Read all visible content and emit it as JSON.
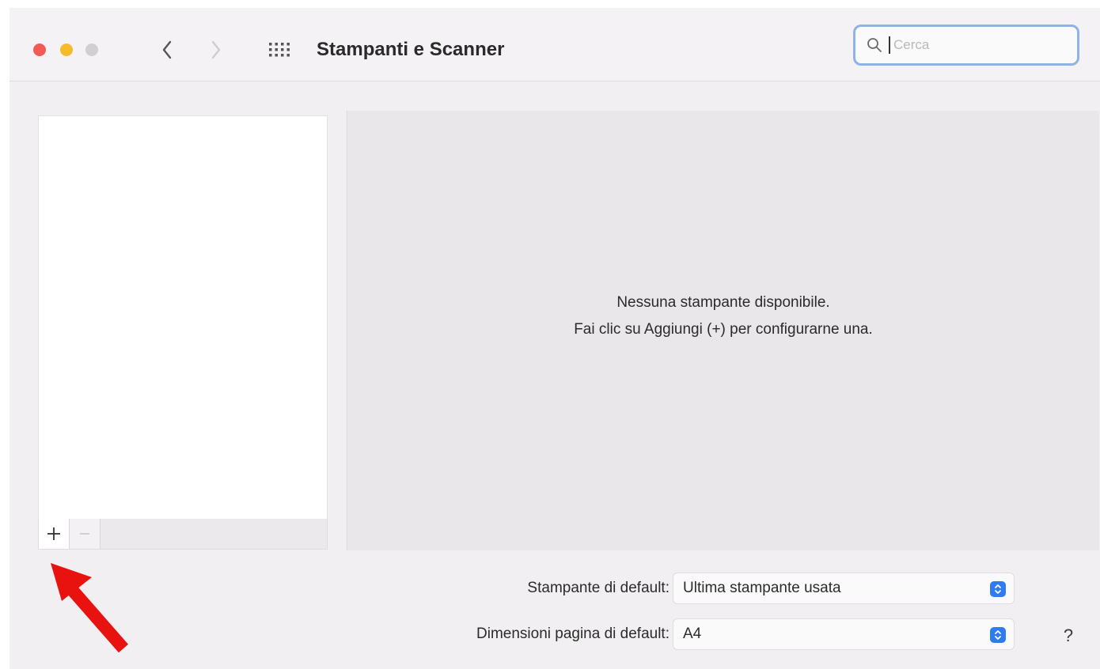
{
  "window": {
    "title": "Stampanti e Scanner",
    "search": {
      "placeholder": "Cerca",
      "value": ""
    }
  },
  "icons": {
    "back": "chevron-left-icon",
    "forward": "chevron-right-icon",
    "grid": "grid-icon",
    "search": "magnifier-icon",
    "add": "plus-icon",
    "remove": "minus-icon",
    "annotation": "red-arrow-icon"
  },
  "detail": {
    "empty_line1": "Nessuna stampante disponibile.",
    "empty_line2": "Fai clic su Aggiungi (+) per configurarne una."
  },
  "settings": {
    "default_printer_label": "Stampante di default:",
    "default_printer_value": "Ultima stampante usata",
    "paper_size_label": "Dimensioni pagina di default:",
    "paper_size_value": "A4"
  },
  "help": {
    "label": "?"
  },
  "colors": {
    "close": "#f25a55",
    "minimize": "#f6bb2d",
    "zoom": "#d1cfd1",
    "accent": "#2f7bf5",
    "annotation_arrow": "#e8130f"
  }
}
